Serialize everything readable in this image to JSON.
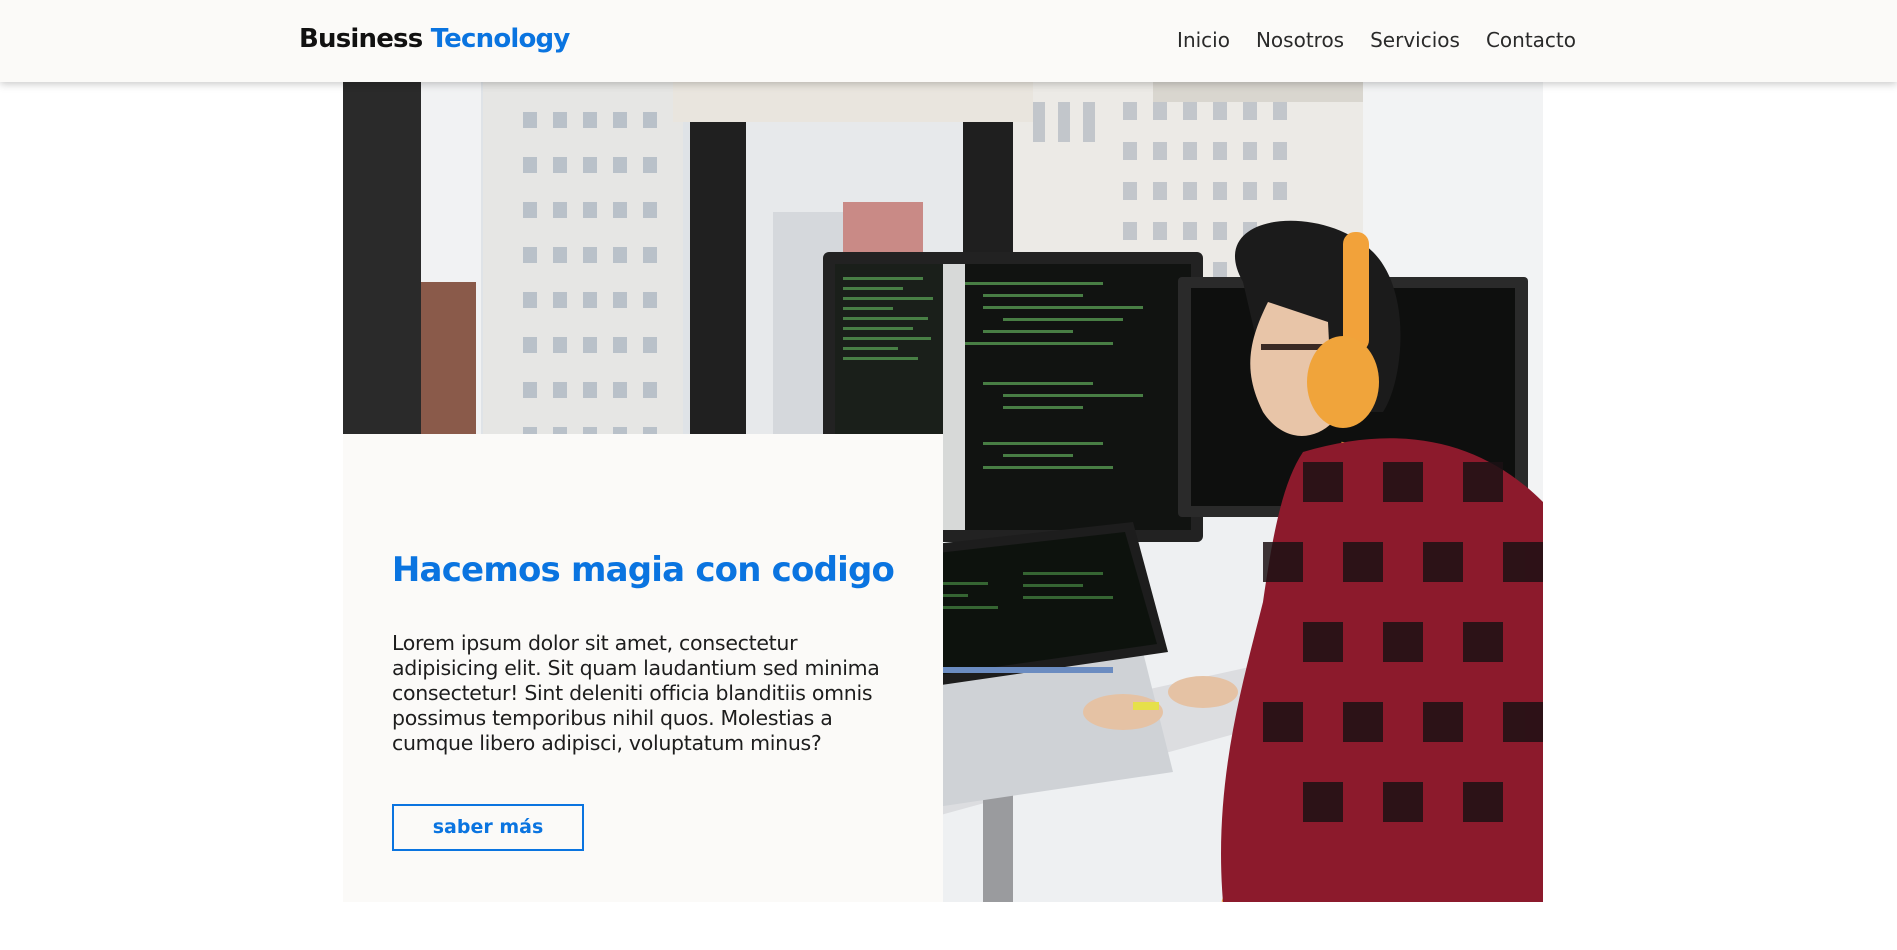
{
  "header": {
    "logo_part1": "Business",
    "logo_part2": "Tecnology",
    "nav": [
      "Inicio",
      "Nosotros",
      "Servicios",
      "Contacto"
    ]
  },
  "hero": {
    "title": "Hacemos magia con codigo",
    "text": "Lorem ipsum dolor sit amet, consectetur adipisicing elit. Sit quam laudantium sed minima consectetur! Sint deleniti officia blanditiis omnis possimus temporibus nihil quos. Molestias a cumque libero adipisci, voluptatum minus?",
    "button_label": "saber más",
    "image": "photo of developer with headphones at monitors"
  },
  "colors": {
    "accent": "#0a74e0",
    "header_bg": "#fbfaf8",
    "text": "#1d1d1d"
  }
}
